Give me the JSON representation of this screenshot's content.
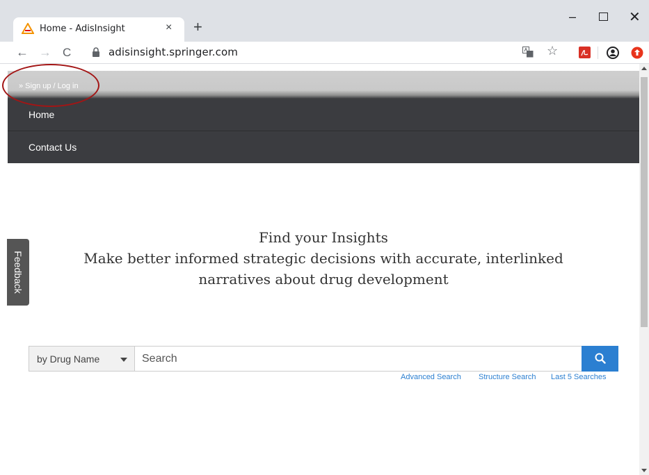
{
  "browser": {
    "tab_title": "Home - AdisInsight",
    "tab_close": "×",
    "new_tab": "+",
    "url": "adisinsight.springer.com",
    "icons": [
      "adis-favicon-icon",
      "back-icon",
      "forward-icon",
      "reload-icon",
      "lock-icon",
      "translate-icon",
      "star-icon",
      "pdf-icon",
      "account-icon",
      "extension-icon"
    ],
    "window": {
      "minimize": "–",
      "close": "✕"
    },
    "nav": {
      "back": "←",
      "forward": "→",
      "reload": "C",
      "star": "☆"
    }
  },
  "page": {
    "login_link": "» Sign up / Log in",
    "nav_items": [
      {
        "label": "Home"
      },
      {
        "label": "Contact Us"
      }
    ],
    "feedback": "Feedback",
    "hero": {
      "title": "Find your Insights",
      "subtitle_line1": "Make better informed strategic decisions with accurate, interlinked",
      "subtitle_line2": "narratives about drug development"
    },
    "search": {
      "type_selected": "by Drug Name",
      "placeholder": "Search",
      "value": "",
      "links": {
        "advanced": "Advanced Search",
        "structure": "Structure Search",
        "last5": "Last 5 Searches"
      }
    }
  },
  "colors": {
    "nav_bg": "#3b3c40",
    "accent": "#2b7fd1",
    "annotation": "#a31515",
    "favicon": "#f39200"
  }
}
